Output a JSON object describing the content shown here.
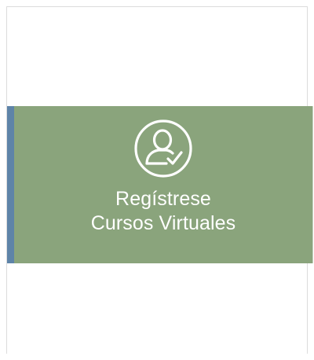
{
  "tile": {
    "line1": "Regístrese",
    "line2": "Cursos Virtuales",
    "icon": "user-check-icon"
  },
  "colors": {
    "tile_background": "#8aa47c",
    "left_accent": "#5e84a8",
    "text": "#ffffff"
  }
}
